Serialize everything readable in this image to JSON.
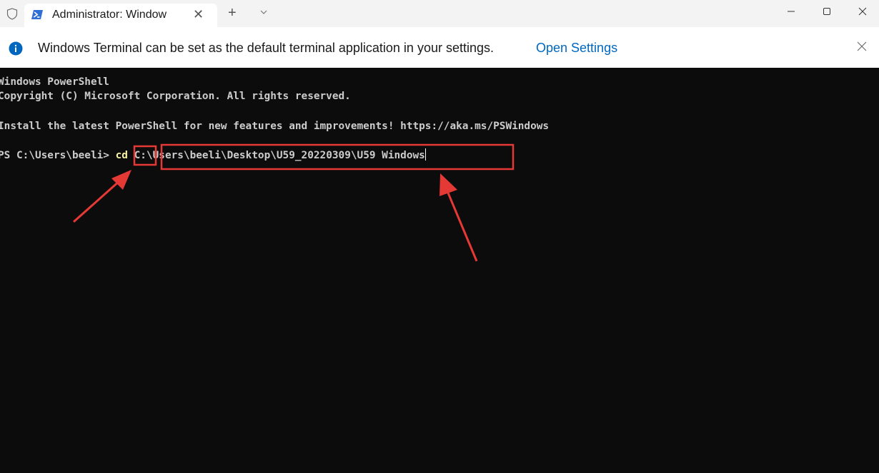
{
  "window": {
    "tab_title": "Administrator: Window",
    "tab_close_glyph": "✕",
    "new_tab_glyph": "+"
  },
  "infobar": {
    "message": "Windows Terminal can be set as the default terminal application in your settings.",
    "link_label": "Open Settings"
  },
  "terminal": {
    "lines": [
      "Windows PowerShell",
      "Copyright (C) Microsoft Corporation. All rights reserved.",
      "Install the latest PowerShell for new features and improvements! https://aka.ms/PSWindows"
    ],
    "prompt": "PS C:\\Users\\beeli> ",
    "command": "cd",
    "argument": "C:\\Users\\beeli\\Desktop\\U59_20220309\\U59 Windows"
  },
  "colors": {
    "terminal_bg": "#0c0c0c",
    "terminal_text": "#cccccc",
    "command_text": "#f9f1a5",
    "link": "#0067c0",
    "info_icon": "#0067c0",
    "annotation": "#e53935"
  },
  "icons": {
    "shield": "shield-icon",
    "powershell": "powershell-icon",
    "info": "info-icon",
    "close": "close-icon",
    "chevron": "chevron-down-icon"
  }
}
